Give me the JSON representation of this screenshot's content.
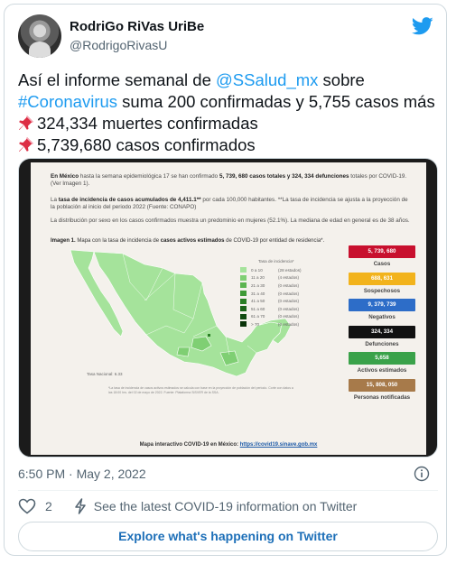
{
  "tweet": {
    "display_name": "RodriGo RiVas UriBe",
    "handle": "@RodrigoRivasU",
    "text": {
      "line1_pre": "Así el informe semanal de ",
      "line1_mention": "@SSalud_mx",
      "line1_post": " sobre",
      "line2_hashtag": "#Coronavirus",
      "line2_post": " suma 200 confirmadas y 5,755 casos más",
      "line3": "324,334 muertes confirmadas",
      "line4": "5,739,680 casos confirmados"
    },
    "timestamp": "6:50 PM · May 2, 2022",
    "like_count": "2",
    "covid_info": "See the latest COVID-19 information on Twitter",
    "explore_label": "Explore what's happening on Twitter"
  },
  "report": {
    "p1_country": "En México",
    "p1_text1": " hasta la semana epidemiológica 17 se han confirmado ",
    "p1_total": "5, 739, 680 casos totales y 324, 334 defunciones",
    "p1_text2": " totales por COVID-19. (Ver Imagen 1).",
    "p2_text1": "La ",
    "p2_bold": "tasa de incidencia de casos acumulados de 4,411.1**",
    "p2_text2": " por cada 100,000 habitantes. **La tasa de incidencia se ajusta a la proyección de la población al inicio del periodo 2022 (Fuente: CONAPO)",
    "p3": "La distribución por sexo en los casos confirmados muestra un predominio en mujeres (52.1%). La mediana de edad en general es de 38 años.",
    "map_title_bold": "Imagen 1.",
    "map_title_text1": " Mapa con la tasa de incidencia de ",
    "map_title_bold2": "casos activos estimados",
    "map_title_text2": " de COVID-19 por entidad de residencia*.",
    "legend_header": "Tasa de incidencia*",
    "legend": [
      {
        "range": "0 a 10",
        "count": "(28 estados)",
        "color": "#a5e39b"
      },
      {
        "range": "11 a 20",
        "count": "(4 estados)",
        "color": "#7fcf73"
      },
      {
        "range": "21 a 30",
        "count": "(0 estados)",
        "color": "#5cb450"
      },
      {
        "range": "31 a 40",
        "count": "(0 estados)",
        "color": "#3e9a36"
      },
      {
        "range": "41 a 50",
        "count": "(0 estados)",
        "color": "#2a7f25"
      },
      {
        "range": "51 a 60",
        "count": "(0 estados)",
        "color": "#1c6519"
      },
      {
        "range": "61 a 70",
        "count": "(0 estados)",
        "color": "#114b10"
      },
      {
        "range": "> 70",
        "count": "(0 estados)",
        "color": "#0a3309"
      }
    ],
    "tasa_nacional": "Tasa Nacional: 6.33",
    "notes": "*La tasa de incidencia de casos activos estimados se calcula con base en la proyección de población del periodo. Corte con datos a las 18:00 hrs. del 02 de mayo de 2022. Fuente: Plataforma SISVER de la SSA.",
    "stats": [
      {
        "value": "5, 739, 680",
        "label": "Casos",
        "color": "#c8102e"
      },
      {
        "value": "688, 631",
        "label": "Sospechosos",
        "color": "#f2b31c"
      },
      {
        "value": "9, 379, 739",
        "label": "Negativos",
        "color": "#2d6dc8"
      },
      {
        "value": "324, 334",
        "label": "Defunciones",
        "color": "#111111"
      },
      {
        "value": "5,658",
        "label": "Activos estimados",
        "color": "#3aa24a"
      },
      {
        "value": "15, 808, 050",
        "label": "Personas notificadas",
        "color": "#a77a4a"
      }
    ],
    "map_link_text": "Mapa interactivo COVID-19 en México: ",
    "map_link_url": "https://covid19.sinave.gob.mx"
  },
  "colors": {
    "accent": "#1d9bf0",
    "map_fill": "#a5e39b",
    "map_fill_alt": "#7fcf73"
  }
}
